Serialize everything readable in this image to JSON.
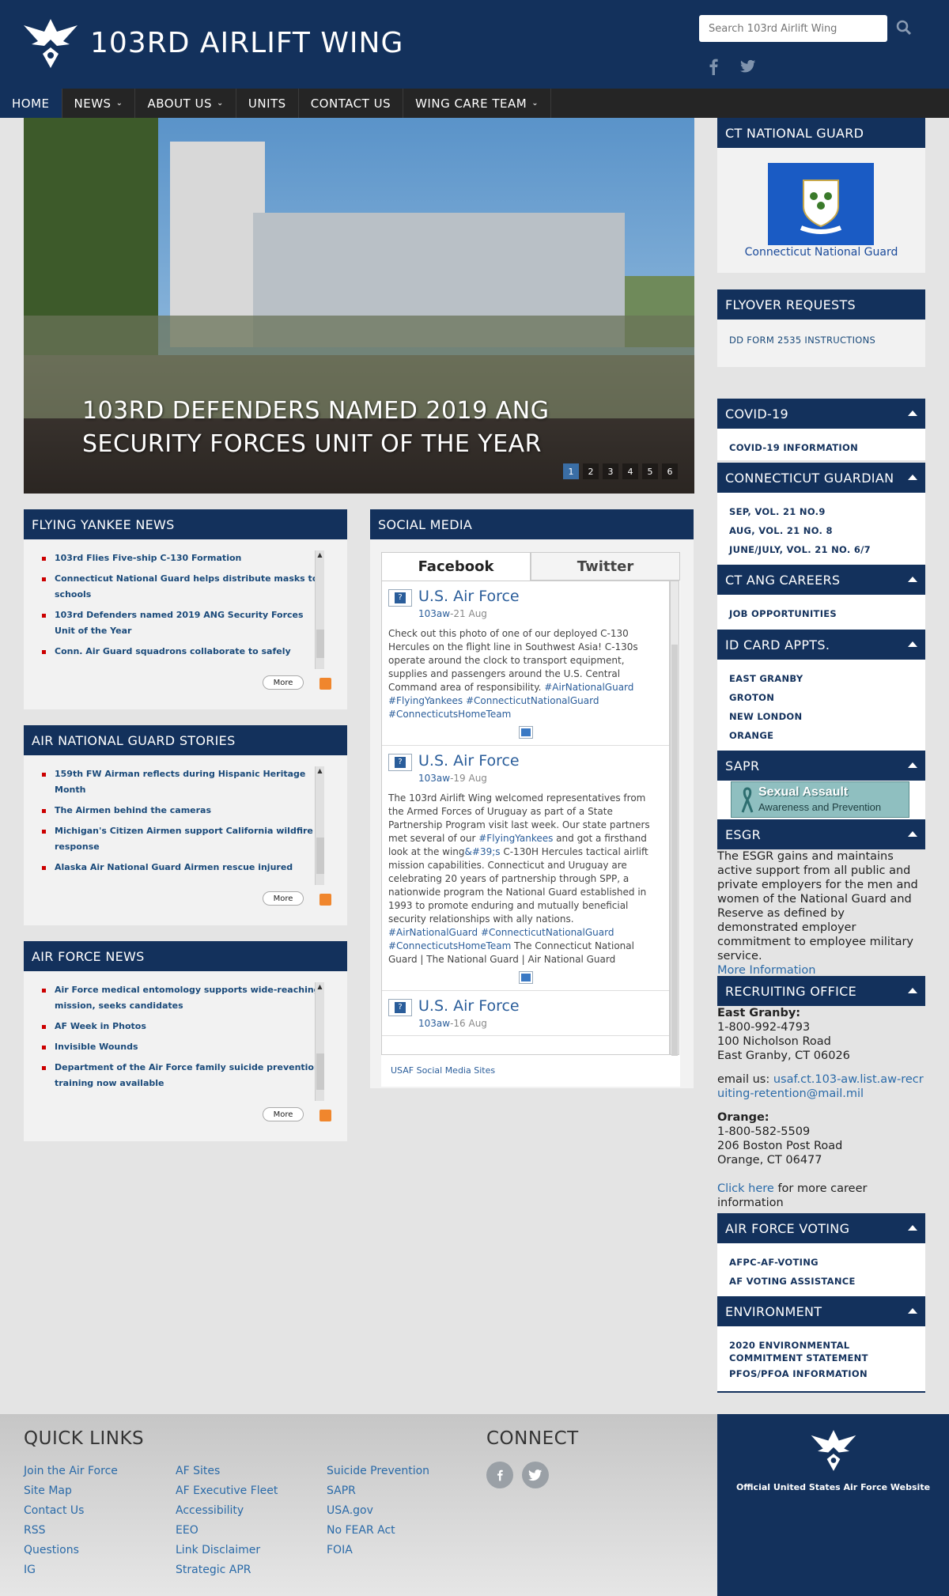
{
  "header": {
    "title": "103RD AIRLIFT WING",
    "search_placeholder": "Search 103rd Airlift Wing"
  },
  "nav": {
    "items": [
      {
        "label": "HOME",
        "dropdown": false
      },
      {
        "label": "NEWS",
        "dropdown": true
      },
      {
        "label": "ABOUT US",
        "dropdown": true
      },
      {
        "label": "UNITS",
        "dropdown": false
      },
      {
        "label": "CONTACT US",
        "dropdown": false
      },
      {
        "label": "WING CARE TEAM",
        "dropdown": true
      }
    ]
  },
  "hero": {
    "caption": "103RD DEFENDERS NAMED 2019 ANG SECURITY FORCES UNIT OF THE YEAR",
    "dots": [
      "1",
      "2",
      "3",
      "4",
      "5",
      "6"
    ],
    "active_dot": 1
  },
  "flying_yankee": {
    "title": "FLYING YANKEE NEWS",
    "items": [
      "103rd Flies Five-ship C-130 Formation",
      "Connecticut National Guard helps distribute masks to schools",
      "103rd Defenders named 2019 ANG Security Forces Unit of the Year",
      "Conn. Air Guard squadrons collaborate to safely"
    ],
    "more": "More"
  },
  "ang_stories": {
    "title": "AIR NATIONAL GUARD STORIES",
    "items": [
      "159th FW Airman reflects during Hispanic Heritage Month",
      "The Airmen behind the cameras",
      "Michigan's Citizen Airmen support California wildfire response",
      "Alaska Air National Guard Airmen rescue injured"
    ],
    "more": "More"
  },
  "af_news": {
    "title": "AIR FORCE NEWS",
    "items": [
      "Air Force medical entomology supports wide-reaching mission, seeks candidates",
      "AF Week in Photos",
      "Invisible Wounds",
      "Department of the Air Force family suicide prevention training now available"
    ],
    "more": "More"
  },
  "social": {
    "title": "SOCIAL MEDIA",
    "tabs": [
      "Facebook",
      "Twitter"
    ],
    "posts": [
      {
        "author": "U.S. Air Force",
        "handle": "103aw",
        "date": "-21 Aug",
        "text": "Check out this photo of one of our deployed C-130 Hercules on the flight line in Southwest Asia! C-130s operate around the clock to transport equipment, supplies and passengers around the U.S. Central Command area of responsibility. ",
        "tags": "#AirNationalGuard #FlyingYankees #ConnecticutNationalGuard #ConnecticutsHomeTeam"
      },
      {
        "author": "U.S. Air Force",
        "handle": "103aw",
        "date": "-19 Aug",
        "text_a": "The 103rd Airlift Wing welcomed representatives from the Armed Forces of Uruguay as part of a State Partnership Program visit last week. Our state partners met several of our ",
        "tag_a": "#FlyingYankees",
        "text_b": " and got a firsthand look at the wing",
        "tag_b": "&#39;s",
        "text_c": " C-130H Hercules tactical airlift mission capabilities. Connecticut and Uruguay are celebrating 20 years of partnership through SPP, a nationwide program the National Guard established in 1993 to promote enduring and mutually beneficial security relationships with ally nations. ",
        "tags": "#AirNationalGuard #ConnecticutNationalGuard #ConnecticutsHomeTeam",
        "text_d": " The Connecticut National Guard | The National Guard | Air National Guard"
      },
      {
        "author": "U.S. Air Force",
        "handle": "103aw",
        "date": "-16 Aug"
      }
    ],
    "footer_link": "USAF Social Media Sites"
  },
  "sidebar": {
    "ct_guard": {
      "title": "CT NATIONAL GUARD",
      "caption": "Connecticut National Guard"
    },
    "flyover": {
      "title": "FLYOVER REQUESTS",
      "link": "DD FORM 2535 INSTRUCTIONS"
    },
    "covid": {
      "title": "COVID-19",
      "links": [
        "COVID-19 INFORMATION"
      ]
    },
    "guardian": {
      "title": "CONNECTICUT GUARDIAN",
      "links": [
        "SEP, VOL. 21 NO.9",
        "AUG, VOL. 21 NO. 8",
        "JUNE/JULY, VOL. 21 NO. 6/7"
      ]
    },
    "careers": {
      "title": "CT ANG CAREERS",
      "links": [
        "JOB OPPORTUNITIES"
      ]
    },
    "id_card": {
      "title": "ID CARD APPTS.",
      "links": [
        "EAST GRANBY",
        "GROTON",
        "NEW LONDON",
        "ORANGE"
      ]
    },
    "sapr": {
      "title": "SAPR",
      "banner_line1": "Sexual Assault",
      "banner_line2": "Awareness and Prevention"
    },
    "esgr": {
      "title": "ESGR",
      "text": "The ESGR gains and maintains active support from all public and private employers for the men and women of the National Guard and Reserve as defined by demonstrated employer commitment to employee military service.",
      "link": "More Information"
    },
    "recruiting": {
      "title": "RECRUITING OFFICE",
      "eg_label": "East Granby:",
      "eg_phone": "1-800-992-4793",
      "eg_addr1": "100 Nicholson Road",
      "eg_addr2": "East Granby, CT 06026",
      "email_label": "email us: ",
      "email": "usaf.ct.103-aw.list.aw-recruiting-retention@mail.mil",
      "or_label": "Orange:",
      "or_phone": "1-800-582-5509",
      "or_addr1": "206 Boston Post Road",
      "or_addr2": "Orange, CT 06477",
      "click_here": "Click here",
      "career_text": " for more career information"
    },
    "voting": {
      "title": "AIR FORCE VOTING",
      "links": [
        "AFPC-AF-VOTING",
        "AF VOTING ASSISTANCE"
      ]
    },
    "environment": {
      "title": "ENVIRONMENT",
      "links": [
        "2020 ENVIRONMENTAL COMMITMENT STATEMENT",
        "PFOS/PFOA INFORMATION"
      ]
    }
  },
  "footer": {
    "quick_links_title": "QUICK LINKS",
    "connect_title": "CONNECT",
    "col1": [
      "Join the Air Force",
      "Site Map",
      "Contact Us",
      "RSS",
      "Questions",
      "IG"
    ],
    "col2": [
      "AF Sites",
      "AF Executive Fleet",
      "Accessibility",
      "EEO",
      "Link Disclaimer",
      "Strategic APR"
    ],
    "col3": [
      "Suicide Prevention",
      "SAPR",
      "USA.gov",
      "No FEAR Act",
      "FOIA"
    ],
    "af_text": "Official United States Air Force Website"
  },
  "colors": {
    "brand_navy": "#13315c",
    "nav_dark": "#252525",
    "bullet_red": "#cc0000",
    "link_blue": "#2a6aa8"
  }
}
